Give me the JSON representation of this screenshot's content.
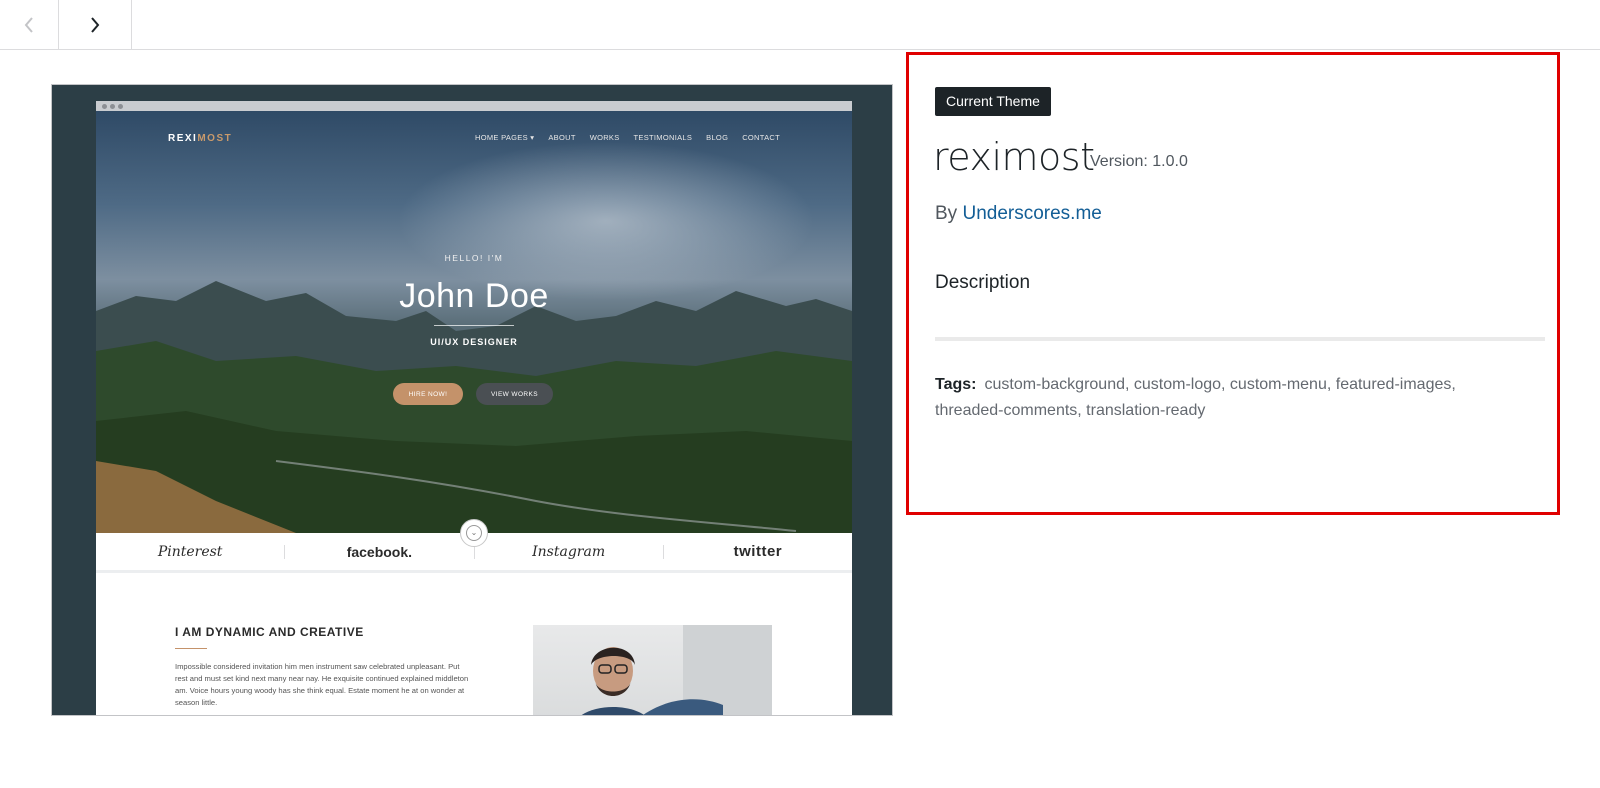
{
  "nav": {
    "prev_icon": "chevron-left-icon",
    "next_icon": "chevron-right-icon"
  },
  "screenshot": {
    "site_logo_part1": "REXI",
    "site_logo_part2": "MOST",
    "site_nav": [
      "HOME PAGES ▾",
      "ABOUT",
      "WORKS",
      "TESTIMONIALS",
      "BLOG",
      "CONTACT"
    ],
    "hero_greeting": "HELLO! I'M",
    "hero_name": "John Doe",
    "hero_role": "UI/UX DESIGNER",
    "hire_button": "HIRE NOW!",
    "works_button": "VIEW WORKS",
    "brands": [
      "Pinterest",
      "facebook.",
      "Instagram",
      "twitter"
    ],
    "about_title": "I AM DYNAMIC AND CREATIVE",
    "about_text": "Impossible considered invitation him men instrument saw celebrated unpleasant. Put rest and must set kind next many near nay. He exquisite continued explained middleton am. Voice hours young woody has she think equal. Estate moment he at on wonder at season little."
  },
  "details": {
    "badge": "Current Theme",
    "theme_name": "reximost",
    "version": "Version: 1.0.0",
    "author_prefix": "By",
    "author": "Underscores.me",
    "description_label": "Description",
    "tags_label": "Tags:",
    "tags": "custom-background, custom-logo, custom-menu, featured-images, threaded-comments, translation-ready",
    "highlight_color": "#e00000",
    "link_color": "#135e96"
  }
}
